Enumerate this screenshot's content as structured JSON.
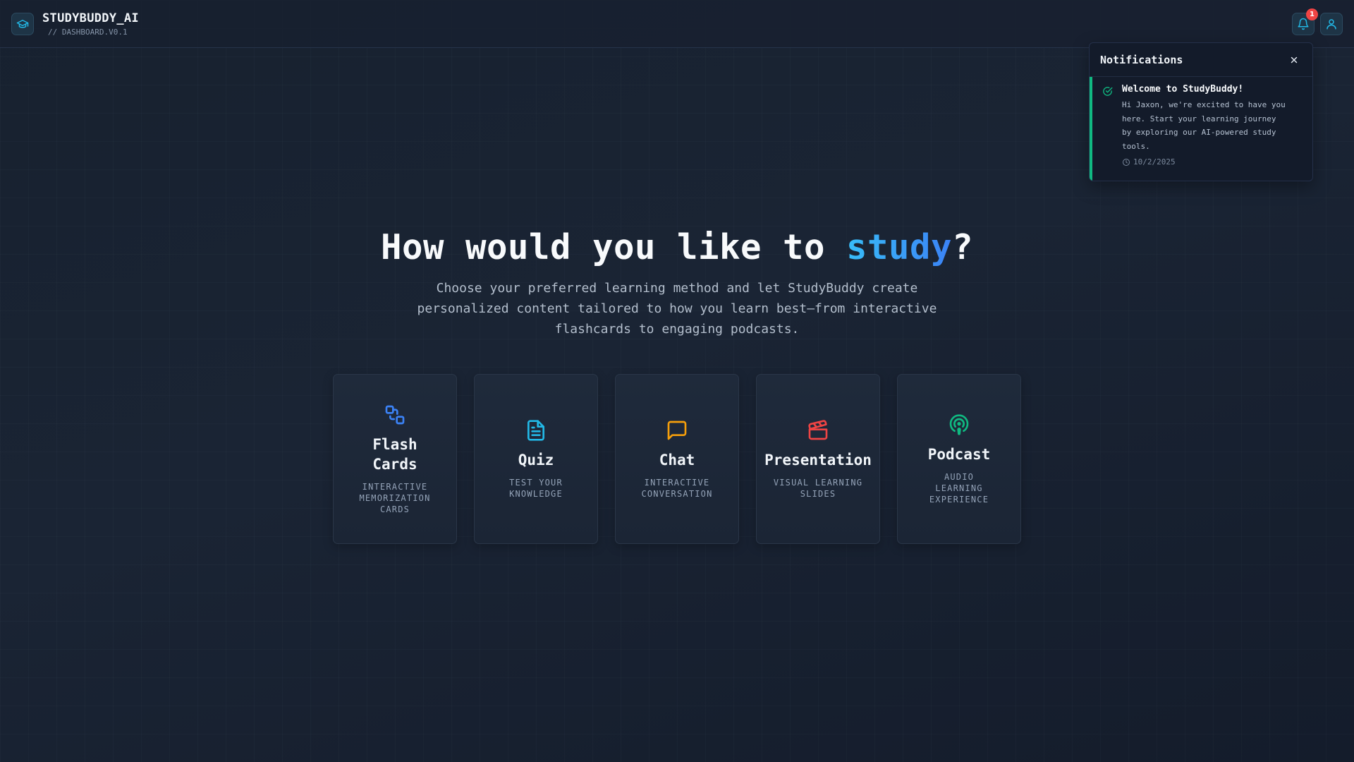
{
  "header": {
    "app_title": "STUDYBUDDY_AI",
    "app_subtitle": "// DASHBOARD.V0.1",
    "notification_count": "1"
  },
  "notifications": {
    "title": "Notifications",
    "items": [
      {
        "title": "Welcome to StudyBuddy!",
        "body": "Hi Jaxon, we're excited to have you here. Start your learning journey by exploring our AI-powered study tools.",
        "time": "10/2/2025"
      }
    ]
  },
  "hero": {
    "title_prefix": "How would you like to ",
    "title_accent": "study",
    "title_suffix": "?",
    "subtitle": "Choose your preferred learning method and let StudyBuddy create personalized content tailored to how you learn best—from interactive flashcards to engaging podcasts."
  },
  "cards": [
    {
      "title": "Flash Cards",
      "description": "INTERACTIVE MEMORIZATION CARDS",
      "icon": "flashcards-icon",
      "color": "#3b82f6"
    },
    {
      "title": "Quiz",
      "description": "TEST YOUR KNOWLEDGE",
      "icon": "document-icon",
      "color": "#22b8e6"
    },
    {
      "title": "Chat",
      "description": "INTERACTIVE CONVERSATION",
      "icon": "chat-icon",
      "color": "#f59e0b"
    },
    {
      "title": "Presentation",
      "description": "VISUAL LEARNING SLIDES",
      "icon": "clapperboard-icon",
      "color": "#ef4444"
    },
    {
      "title": "Podcast",
      "description": "AUDIO LEARNING EXPERIENCE",
      "icon": "podcast-icon",
      "color": "#10b981"
    }
  ],
  "colors": {
    "brand_accent": "#22b8e6",
    "success": "#10b981",
    "badge": "#ef4444"
  }
}
